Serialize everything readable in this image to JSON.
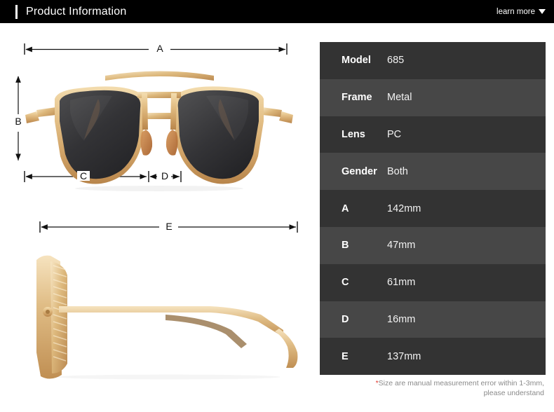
{
  "header": {
    "title": "Product Information",
    "learn_more": "learn more",
    "caret_icon": "chevron-down-icon",
    "bg_color": "#000000",
    "accent_color": "#ffffff"
  },
  "diagram": {
    "front_view": {
      "alt": "sunglasses-front-view",
      "dimension_labels": [
        "A",
        "B",
        "C",
        "D"
      ]
    },
    "side_view": {
      "alt": "sunglasses-side-view",
      "dimension_labels": [
        "E"
      ]
    },
    "label_a": "A",
    "label_b": "B",
    "label_c": "C",
    "label_d": "D",
    "label_e": "E"
  },
  "spec_table": {
    "rows": [
      {
        "key": "Model",
        "value": "685"
      },
      {
        "key": "Frame",
        "value": "Metal"
      },
      {
        "key": "Lens",
        "value": "PC"
      },
      {
        "key": "Gender",
        "value": "Both"
      },
      {
        "key": "A",
        "value": "142mm"
      },
      {
        "key": "B",
        "value": "47mm"
      },
      {
        "key": "C",
        "value": "61mm"
      },
      {
        "key": "D",
        "value": "16mm"
      },
      {
        "key": "E",
        "value": "137mm"
      }
    ],
    "row_color_odd": "#333333",
    "row_color_even": "#474747"
  },
  "note": {
    "star": "*",
    "line1": "Size are manual measurement error within 1-3mm,",
    "line2": "please understand",
    "star_color": "#e03a2f"
  }
}
